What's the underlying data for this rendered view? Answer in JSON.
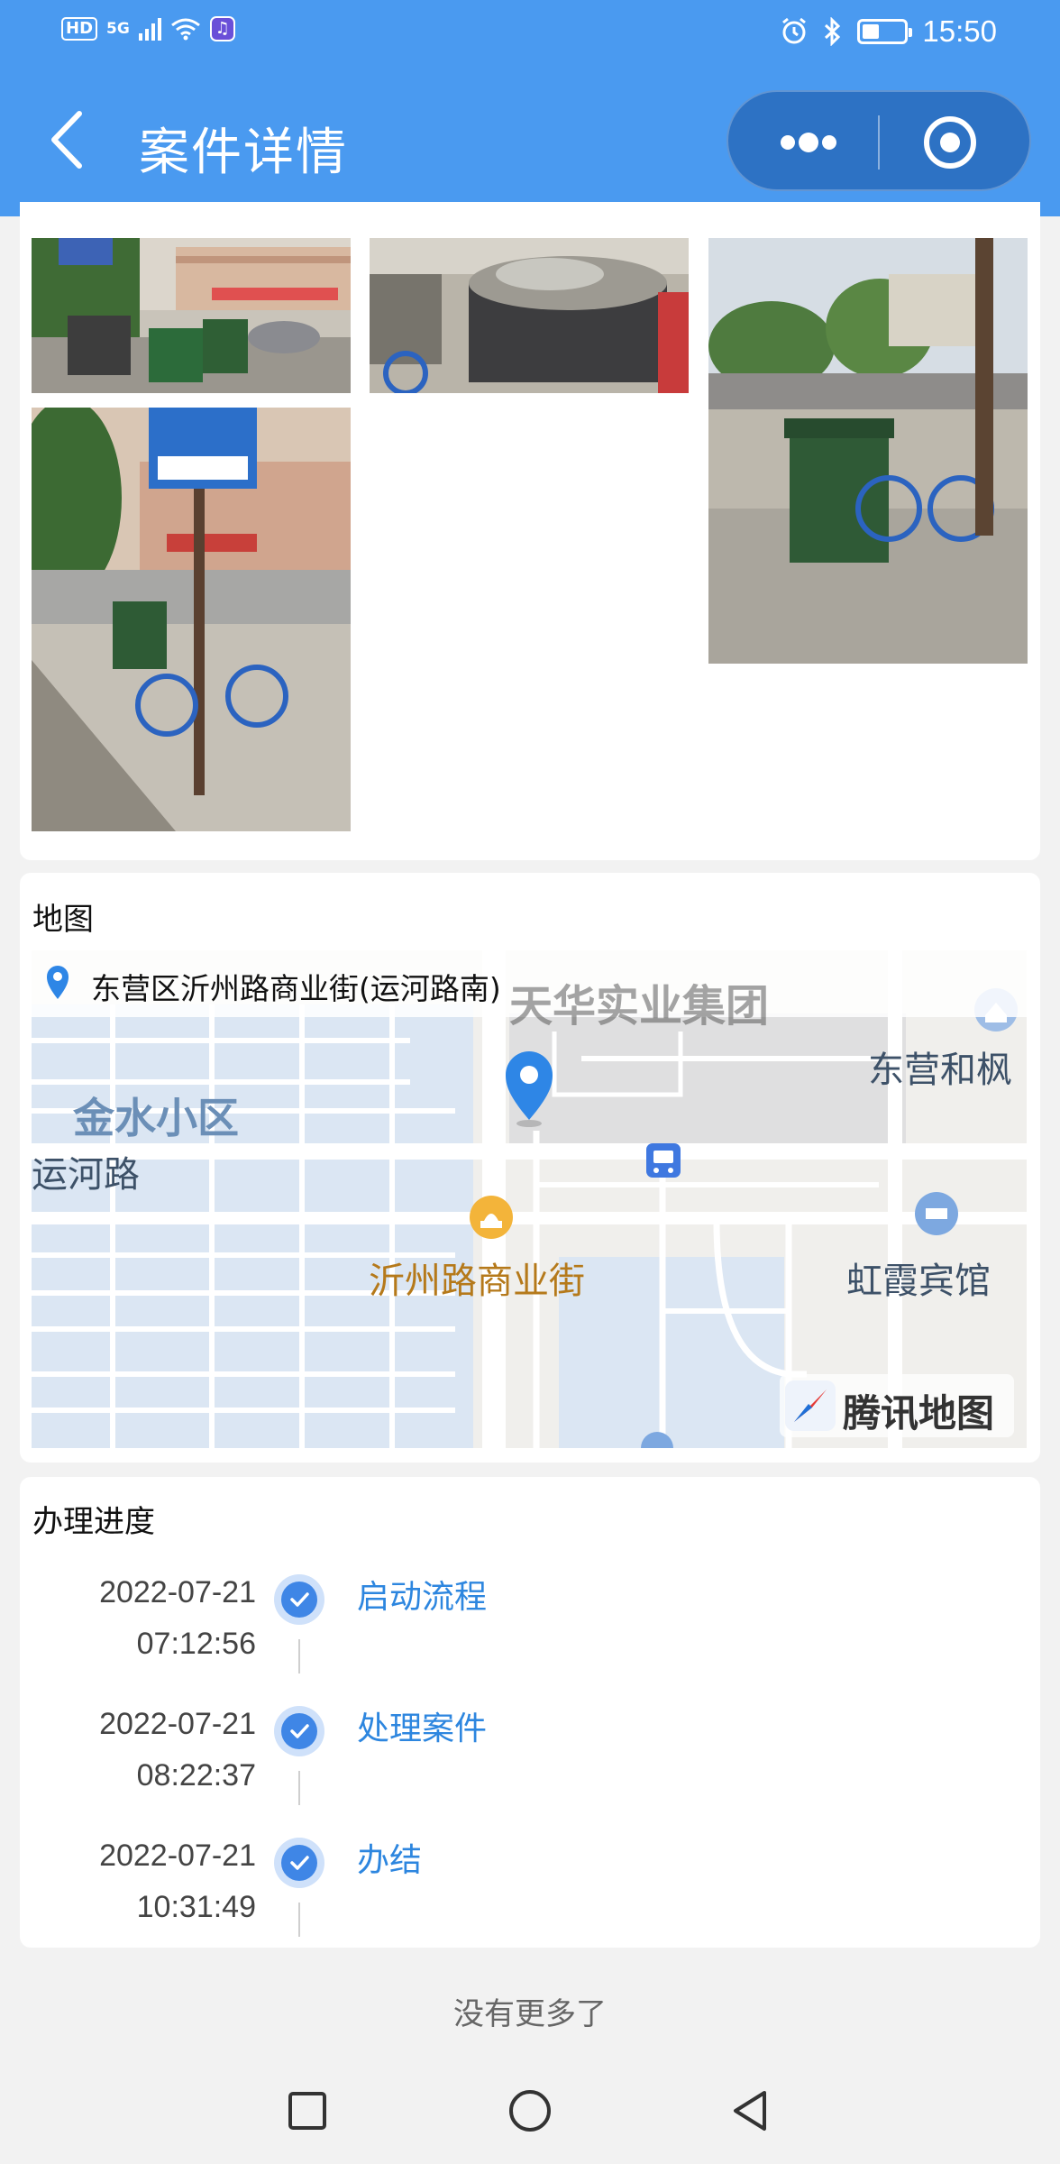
{
  "status_bar": {
    "network_badge": "HD",
    "signal_label": "5G",
    "time": "15:50",
    "battery_level": 0.4,
    "icons": [
      "signal-icon",
      "wifi-icon",
      "music-app-icon",
      "alarm-icon",
      "bluetooth-icon",
      "battery-icon"
    ]
  },
  "header": {
    "title": "案件详情",
    "background_color": "#4a9af0",
    "back_icon": "chevron-left-icon",
    "more_icon": "more-dots-icon",
    "close_icon": "target-circle-icon"
  },
  "photos": {
    "count": 4,
    "descriptions_icons": [
      "photo-thumbnail",
      "photo-thumbnail",
      "photo-thumbnail",
      "photo-thumbnail"
    ]
  },
  "map_section": {
    "label": "地图",
    "address": "东营区沂州路商业街(运河路南)",
    "labels": {
      "top_group": "天华实业集团",
      "donging_hefeng": "东营和枫",
      "jinshui": "金水小区",
      "yunhe_road": "运河路",
      "yizhou_street": "沂州路商业街",
      "hongxia_hotel": "虹霞宾馆",
      "brand": "腾讯地图"
    },
    "accent_color": "#2d86df"
  },
  "progress": {
    "label": "办理进度",
    "steps": [
      {
        "date": "2022-07-21",
        "time": "07:12:56",
        "label": "启动流程"
      },
      {
        "date": "2022-07-21",
        "time": "08:22:37",
        "label": "处理案件"
      },
      {
        "date": "2022-07-21",
        "time": "10:31:49",
        "label": "办结"
      }
    ],
    "step_color": "#3f86e6"
  },
  "footer": {
    "no_more": "没有更多了"
  },
  "system_nav": {
    "icons": [
      "square-recents-icon",
      "circle-home-icon",
      "triangle-back-icon"
    ]
  }
}
